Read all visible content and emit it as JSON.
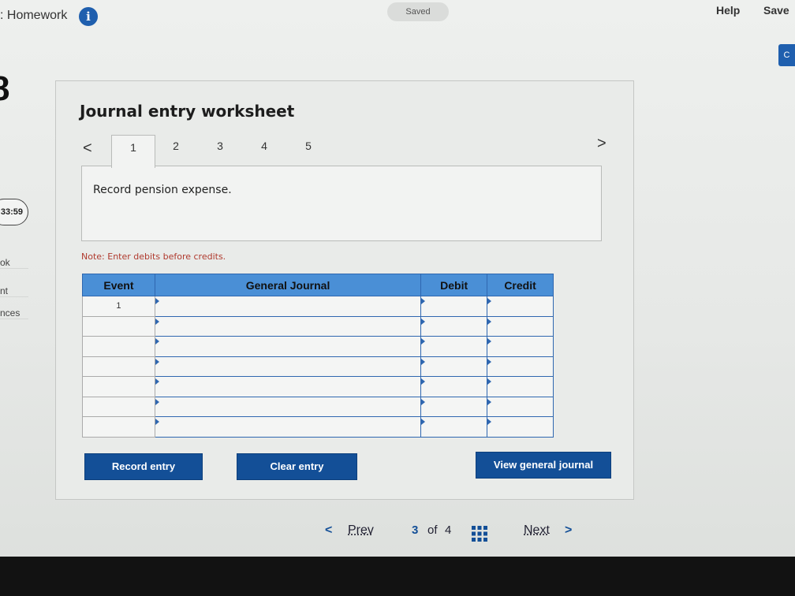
{
  "header": {
    "title": ": Homework",
    "info_icon": "i",
    "saved": "Saved",
    "help": "Help",
    "save": "Save",
    "corner_button": "C"
  },
  "sidebar": {
    "question_number": "8",
    "timer": "33:59",
    "items": [
      "ok",
      "nt",
      "nces"
    ]
  },
  "worksheet": {
    "title": "Journal entry worksheet",
    "prev_arrow": "<",
    "next_arrow": ">",
    "tabs": [
      "1",
      "2",
      "3",
      "4",
      "5"
    ],
    "active_tab": "1",
    "description": "Record pension expense.",
    "note": "Note: Enter debits before credits.",
    "table": {
      "headers": [
        "Event",
        "General Journal",
        "Debit",
        "Credit"
      ],
      "rows": [
        {
          "event": "1"
        },
        {
          "event": ""
        },
        {
          "event": ""
        },
        {
          "event": ""
        },
        {
          "event": ""
        },
        {
          "event": ""
        },
        {
          "event": ""
        }
      ]
    },
    "buttons": {
      "record": "Record entry",
      "clear": "Clear entry",
      "view": "View general journal"
    }
  },
  "pager": {
    "prev_arrow": "<",
    "prev": "Prev",
    "current": "3",
    "of": "of",
    "total": "4",
    "next": "Next",
    "next_arrow": ">"
  },
  "colors": {
    "accent": "#134f97",
    "table_header": "#4a8fd6",
    "note_text": "#b03a2e"
  }
}
